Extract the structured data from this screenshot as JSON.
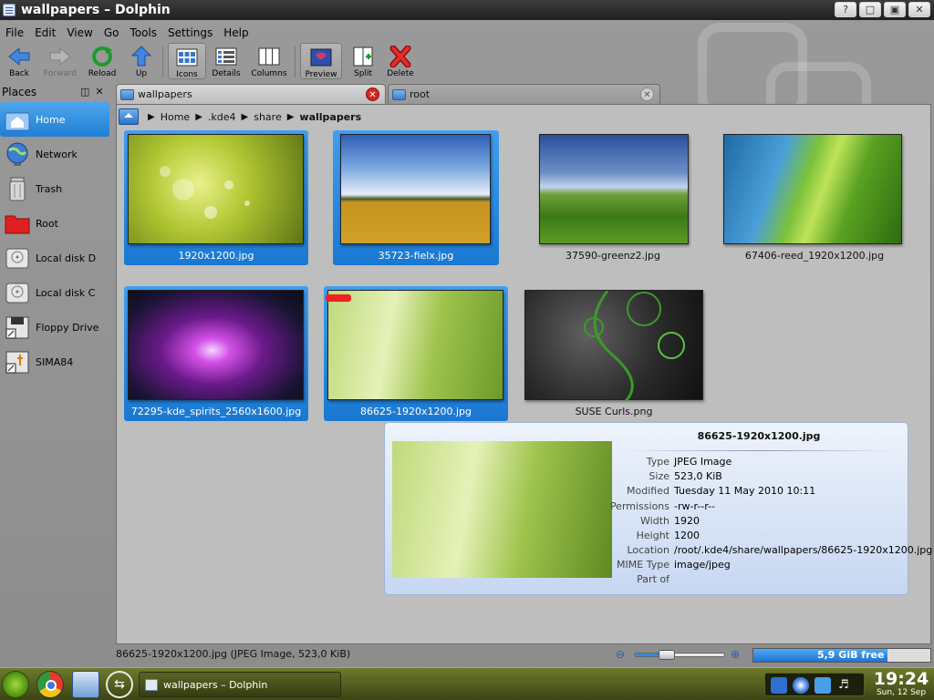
{
  "window": {
    "title": "wallpapers – Dolphin",
    "buttons": [
      "help",
      "minimize",
      "maximize",
      "close"
    ]
  },
  "menubar": [
    "File",
    "Edit",
    "View",
    "Go",
    "Tools",
    "Settings",
    "Help"
  ],
  "toolbar": {
    "back": "Back",
    "forward": "Forward",
    "reload": "Reload",
    "up": "Up",
    "icons": "Icons",
    "details": "Details",
    "columns": "Columns",
    "preview": "Preview",
    "split": "Split",
    "delete": "Delete"
  },
  "places": {
    "title": "Places",
    "items": [
      {
        "label": "Home",
        "icon": "home-folder-icon",
        "selected": true
      },
      {
        "label": "Network",
        "icon": "network-globe-icon"
      },
      {
        "label": "Trash",
        "icon": "trash-icon"
      },
      {
        "label": "Root",
        "icon": "red-folder-icon"
      },
      {
        "label": "Local disk D",
        "icon": "hard-disk-icon"
      },
      {
        "label": "Local disk C",
        "icon": "hard-disk-icon"
      },
      {
        "label": "Floppy Drive",
        "icon": "floppy-icon"
      },
      {
        "label": "SIMA84",
        "icon": "usb-drive-icon"
      }
    ]
  },
  "tabs": [
    {
      "label": "wallpapers",
      "active": true
    },
    {
      "label": "root",
      "active": false
    }
  ],
  "breadcrumb": [
    "Home",
    ".kde4",
    "share",
    "wallpapers"
  ],
  "files": [
    {
      "name": "1920x1200.jpg",
      "selected": true
    },
    {
      "name": "35723-fielx.jpg",
      "selected": true
    },
    {
      "name": "37590-greenz2.jpg",
      "selected": false
    },
    {
      "name": "67406-reed_1920x1200.jpg",
      "selected": false
    },
    {
      "name": "72295-kde_spirits_2560x1600.jpg",
      "selected": true
    },
    {
      "name": "86625-1920x1200.jpg",
      "selected": true
    },
    {
      "name": "SUSE Curls.png",
      "selected": false
    }
  ],
  "tooltip": {
    "name": "86625-1920x1200.jpg",
    "props": [
      {
        "k": "Type",
        "v": "JPEG Image"
      },
      {
        "k": "Size",
        "v": "523,0 KiB"
      },
      {
        "k": "Modified",
        "v": "Tuesday 11 May 2010 10:11"
      },
      {
        "k": "Permissions",
        "v": "-rw-r--r--"
      },
      {
        "k": "Width",
        "v": "1920"
      },
      {
        "k": "Height",
        "v": "1200"
      },
      {
        "k": "Location",
        "v": "/root/.kde4/share/wallpapers/86625-1920x1200.jpg"
      },
      {
        "k": "MIME Type",
        "v": "image/jpeg"
      },
      {
        "k": "Part of",
        "v": ""
      }
    ]
  },
  "statusbar": {
    "text": "86625-1920x1200.jpg (JPEG Image, 523,0 KiB)",
    "free": "5,9 GiB free",
    "used_fraction": 0.76,
    "zoom_fraction": 0.35
  },
  "taskbar": {
    "window": "wallpapers – Dolphin",
    "time": "19:24",
    "date": "Sun, 12 Sep"
  }
}
